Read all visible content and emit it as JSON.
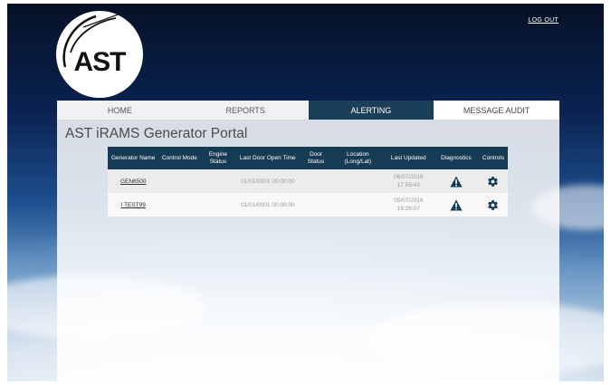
{
  "header": {
    "logo_text": "AST",
    "logout_label": "LOG OUT"
  },
  "nav": {
    "items": [
      {
        "label": "HOME",
        "state": "default"
      },
      {
        "label": "REPORTS",
        "state": "default"
      },
      {
        "label": "ALERTING",
        "state": "active"
      },
      {
        "label": "MESSAGE AUDIT",
        "state": "light"
      }
    ]
  },
  "portal": {
    "title": "AST iRAMS Generator Portal"
  },
  "table": {
    "columns": [
      "Generator Name",
      "Control Mode",
      "Engine Status",
      "Last Door Open Time",
      "Door Status",
      "Location (Long/Lat)",
      "Last Updated",
      "Diagnostics",
      "Controls"
    ],
    "rows": [
      {
        "generator": "GEN6500",
        "control_mode": "",
        "engine_status": "",
        "last_door_open": "01/01/0001 00:00:00",
        "door_status": "",
        "location": "",
        "last_updated": "06/07/2016 17:59:43",
        "diagnostics_icon": "warning-icon",
        "controls_icon": "gear-icon"
      },
      {
        "generator": "I TEST99",
        "control_mode": "",
        "engine_status": "",
        "last_door_open": "01/01/0001 00:00:00",
        "door_status": "",
        "location": "",
        "last_updated": "05/07/2016 19:26:07",
        "diagnostics_icon": "warning-icon",
        "controls_icon": "gear-icon"
      }
    ]
  },
  "colors": {
    "nav_active": "#1b3f58",
    "table_header": "#163b55",
    "icon": "#163b55"
  }
}
